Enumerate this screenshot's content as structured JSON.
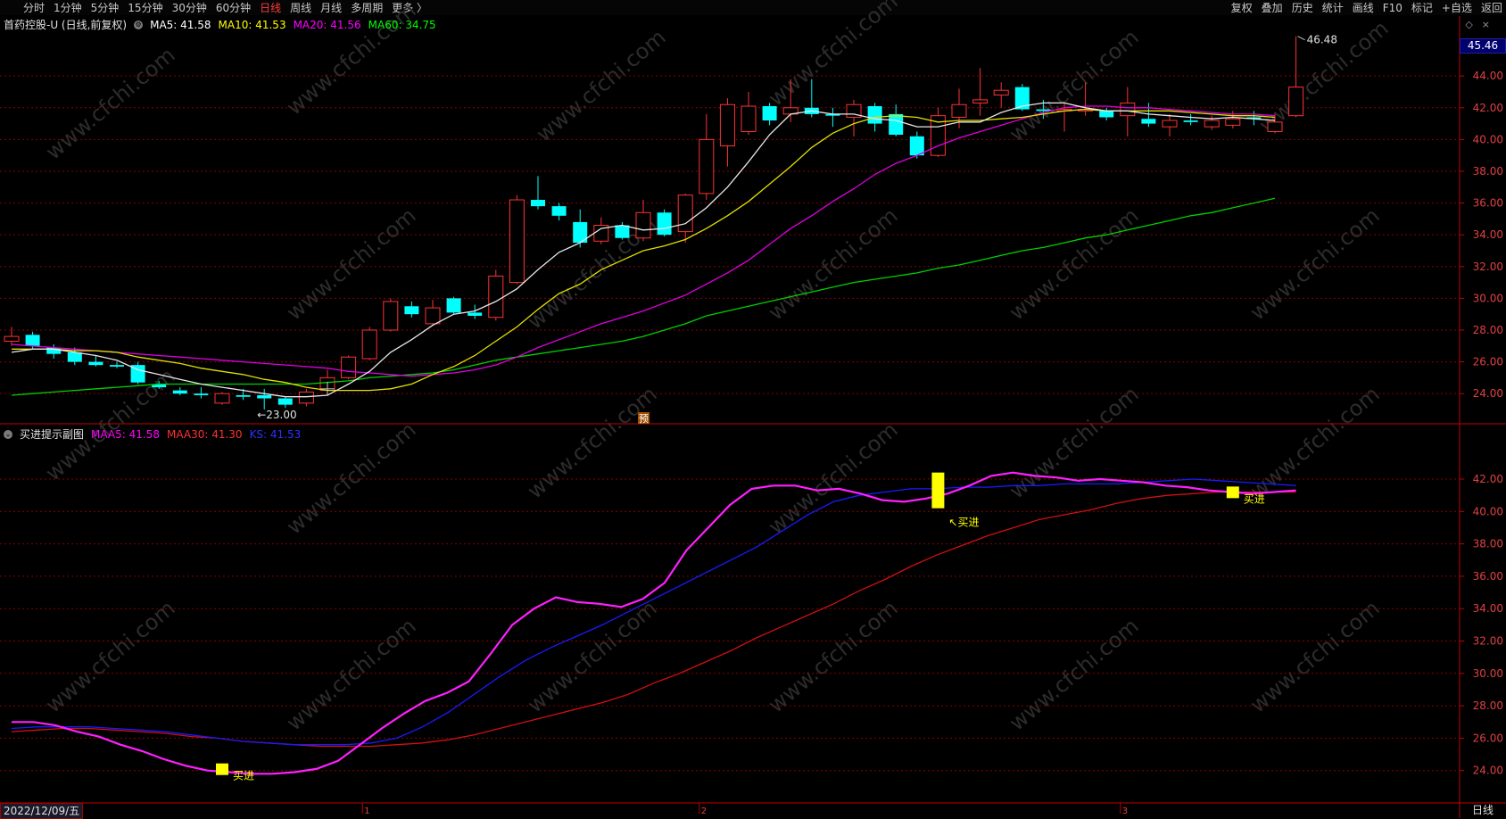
{
  "toolbar": {
    "left": [
      "分时",
      "1分钟",
      "5分钟",
      "15分钟",
      "30分钟",
      "60分钟",
      "日线",
      "周线",
      "月线",
      "多周期",
      "更多 〉"
    ],
    "active": "日线",
    "right": [
      "复权",
      "叠加",
      "历史",
      "统计",
      "画线",
      "F10",
      "标记",
      "+自选",
      "返回"
    ]
  },
  "main_legend": {
    "title": "首药控股-U (日线,前复权)",
    "ma": [
      {
        "label": "MA5: 41.58",
        "color": "#ffffff"
      },
      {
        "label": "MA10: 41.53",
        "color": "#ffff00"
      },
      {
        "label": "MA20: 41.56",
        "color": "#ff00ff"
      },
      {
        "label": "MA60: 34.75",
        "color": "#00ff00"
      }
    ]
  },
  "sub_legend": {
    "title": "买进提示副图",
    "ma": [
      {
        "label": "MAA5: 41.58",
        "color": "#ff00ff"
      },
      {
        "label": "MAA30: 41.30",
        "color": "#ff3030"
      },
      {
        "label": "KS: 41.53",
        "color": "#3030ff"
      }
    ]
  },
  "price_tag": "45.46",
  "annotations": {
    "high": "46.48",
    "low": "23.00",
    "yu": "预",
    "buy": "买进"
  },
  "date_label": "2022/12/09/五",
  "period_label": "日线",
  "month_markers": [
    "1",
    "2",
    "3"
  ],
  "watermark": "www.cfchi.com",
  "colors": {
    "up": "#ff3232",
    "down": "#00ffff",
    "grid": "#8b0000",
    "axis": "#c00000"
  },
  "chart_data": {
    "type": "candlestick",
    "main": {
      "y_ticks": [
        "24.00",
        "26.00",
        "28.00",
        "30.00",
        "32.00",
        "34.00",
        "36.00",
        "38.00",
        "40.00",
        "42.00",
        "44.00"
      ],
      "ylim": [
        22.1,
        47.1
      ],
      "ohlc": [
        [
          27.3,
          28.2,
          27.0,
          27.6
        ],
        [
          27.7,
          27.9,
          26.8,
          27.0
        ],
        [
          26.9,
          27.1,
          26.2,
          26.5
        ],
        [
          26.6,
          26.9,
          25.8,
          26.0
        ],
        [
          26.0,
          26.4,
          25.7,
          25.8
        ],
        [
          25.8,
          26.0,
          25.6,
          25.7
        ],
        [
          25.8,
          26.0,
          24.6,
          24.7
        ],
        [
          24.6,
          24.8,
          24.3,
          24.4
        ],
        [
          24.2,
          24.4,
          23.9,
          24.0
        ],
        [
          24.0,
          24.4,
          23.7,
          23.9
        ],
        [
          23.4,
          24.1,
          23.3,
          24.0
        ],
        [
          23.9,
          24.3,
          23.6,
          23.8
        ],
        [
          23.9,
          24.3,
          23.0,
          23.7
        ],
        [
          23.7,
          23.8,
          23.1,
          23.3
        ],
        [
          23.4,
          24.3,
          23.2,
          24.1
        ],
        [
          24.2,
          25.5,
          24.1,
          25.0
        ],
        [
          25.0,
          26.4,
          24.9,
          26.3
        ],
        [
          26.2,
          28.2,
          26.1,
          28.0
        ],
        [
          28.0,
          30.0,
          27.9,
          29.8
        ],
        [
          29.5,
          29.8,
          28.8,
          29.0
        ],
        [
          28.4,
          29.9,
          28.3,
          29.4
        ],
        [
          30.0,
          30.1,
          29.0,
          29.1
        ],
        [
          29.1,
          29.6,
          28.7,
          28.9
        ],
        [
          28.8,
          31.8,
          28.6,
          31.4
        ],
        [
          31.0,
          36.5,
          30.9,
          36.2
        ],
        [
          36.2,
          37.7,
          35.6,
          35.8
        ],
        [
          35.8,
          36.0,
          34.9,
          35.2
        ],
        [
          34.8,
          35.6,
          33.2,
          33.5
        ],
        [
          33.6,
          35.1,
          33.4,
          34.6
        ],
        [
          34.6,
          34.8,
          33.7,
          33.8
        ],
        [
          33.8,
          36.2,
          33.6,
          35.4
        ],
        [
          35.4,
          35.6,
          33.9,
          34.0
        ],
        [
          34.2,
          36.6,
          33.5,
          36.5
        ],
        [
          36.6,
          41.6,
          36.2,
          40.0
        ],
        [
          39.6,
          42.6,
          38.3,
          42.2
        ],
        [
          40.5,
          43.0,
          40.3,
          42.1
        ],
        [
          42.1,
          42.3,
          40.9,
          41.2
        ],
        [
          41.6,
          43.8,
          41.1,
          42.0
        ],
        [
          42.0,
          43.8,
          41.4,
          41.6
        ],
        [
          41.6,
          42.0,
          40.8,
          41.5
        ],
        [
          41.4,
          42.5,
          40.2,
          42.2
        ],
        [
          42.1,
          42.3,
          40.5,
          41.0
        ],
        [
          41.6,
          42.2,
          40.2,
          40.3
        ],
        [
          40.2,
          40.5,
          38.8,
          39.0
        ],
        [
          39.0,
          42.0,
          38.9,
          41.5
        ],
        [
          41.4,
          43.2,
          40.7,
          42.2
        ],
        [
          42.3,
          44.5,
          41.5,
          42.5
        ],
        [
          42.8,
          43.6,
          42.0,
          43.1
        ],
        [
          43.3,
          43.5,
          41.8,
          41.9
        ],
        [
          41.9,
          42.5,
          41.3,
          41.8
        ],
        [
          41.8,
          42.3,
          40.5,
          41.9
        ],
        [
          41.8,
          43.6,
          41.5,
          41.9
        ],
        [
          41.8,
          42.0,
          41.2,
          41.4
        ],
        [
          41.5,
          43.3,
          40.2,
          42.3
        ],
        [
          41.3,
          42.3,
          40.8,
          41.0
        ],
        [
          40.8,
          41.6,
          40.2,
          41.2
        ],
        [
          41.2,
          41.6,
          40.9,
          41.1
        ],
        [
          40.8,
          41.5,
          40.6,
          41.2
        ],
        [
          40.9,
          41.8,
          40.7,
          41.3
        ],
        [
          41.4,
          41.8,
          40.9,
          41.3
        ],
        [
          40.5,
          41.6,
          40.4,
          41.1
        ],
        [
          41.5,
          46.5,
          41.4,
          43.3
        ]
      ],
      "ma5": [
        26.6,
        26.8,
        26.8,
        26.6,
        26.4,
        26.1,
        25.5,
        25.2,
        24.9,
        24.6,
        24.4,
        24.2,
        24.0,
        23.8,
        23.8,
        23.9,
        24.6,
        25.4,
        26.6,
        27.4,
        28.3,
        29.0,
        29.2,
        29.8,
        30.6,
        31.8,
        32.9,
        33.5,
        34.4,
        34.6,
        34.3,
        34.4,
        34.7,
        35.7,
        37.0,
        38.6,
        40.3,
        41.6,
        41.8,
        41.6,
        41.6,
        41.3,
        41.2,
        40.8,
        40.8,
        41.1,
        41.1,
        41.7,
        42.1,
        42.3,
        42.3,
        42.0,
        41.8,
        41.8,
        41.6,
        41.5,
        41.4,
        41.3,
        41.4,
        41.3,
        41.2,
        41.58
      ],
      "ma10": [
        26.8,
        26.8,
        26.8,
        26.7,
        26.7,
        26.6,
        26.3,
        26.1,
        25.9,
        25.6,
        25.4,
        25.2,
        24.9,
        24.7,
        24.4,
        24.2,
        24.2,
        24.2,
        24.3,
        24.6,
        25.2,
        25.7,
        26.4,
        27.3,
        28.2,
        29.3,
        30.3,
        30.9,
        31.8,
        32.4,
        33.0,
        33.3,
        33.7,
        34.4,
        35.2,
        36.1,
        37.2,
        38.3,
        39.5,
        40.4,
        41.0,
        41.4,
        41.5,
        41.4,
        41.1,
        41.2,
        41.2,
        41.3,
        41.4,
        41.6,
        41.8,
        41.9,
        41.8,
        41.8,
        41.8,
        41.8,
        41.7,
        41.6,
        41.5,
        41.5,
        41.4,
        41.53
      ],
      "ma20": [
        27.1,
        27.0,
        26.9,
        26.8,
        26.7,
        26.6,
        26.5,
        26.4,
        26.3,
        26.2,
        26.1,
        26.0,
        25.9,
        25.8,
        25.7,
        25.6,
        25.4,
        25.3,
        25.2,
        25.1,
        25.2,
        25.3,
        25.5,
        25.8,
        26.3,
        26.9,
        27.4,
        27.9,
        28.4,
        28.8,
        29.2,
        29.7,
        30.2,
        30.9,
        31.6,
        32.4,
        33.4,
        34.4,
        35.2,
        36.1,
        36.9,
        37.8,
        38.5,
        39.0,
        39.6,
        40.1,
        40.5,
        40.9,
        41.3,
        41.7,
        42.0,
        42.1,
        42.1,
        42.0,
        42.0,
        41.9,
        41.8,
        41.7,
        41.6,
        41.6,
        41.5,
        41.56
      ],
      "ma60": [
        23.9,
        24.0,
        24.1,
        24.2,
        24.3,
        24.4,
        24.5,
        24.6,
        24.6,
        24.6,
        24.6,
        24.6,
        24.6,
        24.6,
        24.6,
        24.7,
        24.8,
        25.0,
        25.1,
        25.2,
        25.3,
        25.5,
        25.8,
        26.1,
        26.3,
        26.5,
        26.7,
        26.9,
        27.1,
        27.3,
        27.6,
        28.0,
        28.4,
        28.9,
        29.2,
        29.5,
        29.8,
        30.1,
        30.4,
        30.7,
        31.0,
        31.2,
        31.4,
        31.6,
        31.9,
        32.1,
        32.4,
        32.7,
        33.0,
        33.2,
        33.5,
        33.8,
        34.0,
        34.3,
        34.6,
        34.9,
        35.2,
        35.4,
        35.7,
        36.0,
        36.3,
        34.75
      ]
    },
    "sub": {
      "y_ticks": [
        "24.00",
        "26.00",
        "28.00",
        "30.00",
        "32.00",
        "34.00",
        "36.00",
        "38.00",
        "40.00",
        "42.00"
      ],
      "ylim": [
        22.0,
        44.7
      ],
      "maa5": [
        27.0,
        27.0,
        26.8,
        26.4,
        26.1,
        25.6,
        25.2,
        24.7,
        24.3,
        24.0,
        23.9,
        23.8,
        23.8,
        23.9,
        24.1,
        24.6,
        25.6,
        26.6,
        27.5,
        28.3,
        28.8,
        29.5,
        31.2,
        33.0,
        34.0,
        34.7,
        34.4,
        34.3,
        34.1,
        34.6,
        35.6,
        37.6,
        39.0,
        40.4,
        41.4,
        41.6,
        41.6,
        41.3,
        41.4,
        41.1,
        40.7,
        40.6,
        40.8,
        41.1,
        41.6,
        42.2,
        42.4,
        42.2,
        42.1,
        41.9,
        42.0,
        41.9,
        41.8,
        41.6,
        41.5,
        41.3,
        41.2,
        41.1,
        41.2,
        41.3,
        41.58
      ],
      "maa30": [
        26.4,
        26.5,
        26.6,
        26.6,
        26.5,
        26.4,
        26.3,
        26.1,
        26.0,
        25.8,
        25.7,
        25.6,
        25.5,
        25.5,
        25.5,
        25.6,
        25.7,
        25.9,
        26.2,
        26.6,
        27.0,
        27.4,
        27.8,
        28.2,
        28.7,
        29.4,
        30.0,
        30.7,
        31.4,
        32.2,
        32.9,
        33.6,
        34.3,
        35.1,
        35.8,
        36.6,
        37.3,
        37.9,
        38.5,
        39.0,
        39.5,
        39.8,
        40.1,
        40.5,
        40.8,
        41.0,
        41.1,
        41.2,
        41.2,
        41.2,
        41.2,
        41.3
      ],
      "ks": [
        26.6,
        26.7,
        26.7,
        26.7,
        26.6,
        26.5,
        26.4,
        26.2,
        26.0,
        25.8,
        25.7,
        25.6,
        25.6,
        25.6,
        25.7,
        26.0,
        26.7,
        27.6,
        28.7,
        29.8,
        30.8,
        31.6,
        32.3,
        33.0,
        33.8,
        34.6,
        35.4,
        36.2,
        37.0,
        37.8,
        38.8,
        39.8,
        40.6,
        41.0,
        41.2,
        41.4,
        41.4,
        41.5,
        41.5,
        41.6,
        41.6,
        41.7,
        41.7,
        41.7,
        41.8,
        41.9,
        42.0,
        41.9,
        41.8,
        41.7,
        41.6,
        41.53
      ],
      "signals": [
        {
          "index": 10,
          "value": 24.0,
          "label": "买进"
        },
        {
          "index": 44,
          "value": 40.2,
          "label": "买进"
        },
        {
          "index": 58,
          "value": 41.1,
          "label": "买进"
        }
      ]
    }
  }
}
